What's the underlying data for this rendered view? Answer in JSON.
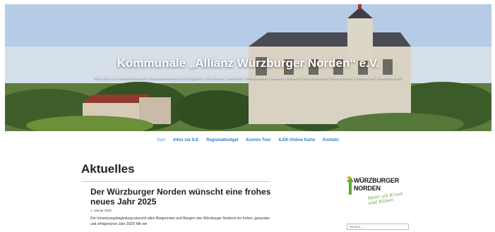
{
  "header": {
    "title": "Kommunale „Allianz Würzburger Norden“ e.V.",
    "subtitle": "Alle Infos zur interkommunalen Zusammenarbeit von Bergtheim, Eisenheim, Estenfeld, Güntersleben, Hausen, Kürnach, Oberpleichfeld, Prosselsheim, Rimpar und Unterpleichfeld"
  },
  "nav": {
    "items": [
      {
        "label": "Start"
      },
      {
        "label": "Infos zur ILE"
      },
      {
        "label": "Regionalbudget"
      },
      {
        "label": "Konnis-Tour"
      },
      {
        "label": "ILEK-Online Karte"
      },
      {
        "label": "Kontakt"
      }
    ],
    "active_index": 0,
    "link_color": "#2a7bd3"
  },
  "main": {
    "section_title": "Aktuelles",
    "post": {
      "title": "Der Würzburger Norden wünscht eine frohes neues Jahr 2025",
      "date": "1. Januar 2025",
      "body": "Die Umsetzungsbegleitung wünscht allen Bürgerinnen und Bürgern des Würzburger Nordens ein frohes, gesundes und erfolgreiches Jahr 2025! Mit viel"
    }
  },
  "sidebar": {
    "logo": {
      "line1": "WÜRZBURGER",
      "line2": "NORDEN",
      "slogan": "Mehr als Kraut und Rüben",
      "accent_color": "#5aa83a"
    },
    "search": {
      "placeholder": "Suchen ..."
    }
  }
}
